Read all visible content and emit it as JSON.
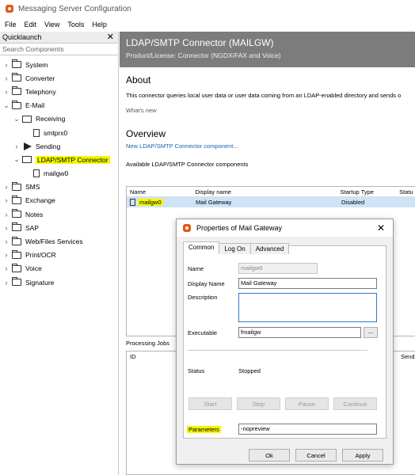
{
  "window": {
    "title": "Messaging Server Configuration"
  },
  "menu": [
    "File",
    "Edit",
    "View",
    "Tools",
    "Help"
  ],
  "quicklaunch": {
    "title": "Quicklaunch",
    "close_glyph": "✕",
    "search_placeholder": "Search Components",
    "tree": [
      {
        "label": "System",
        "chevron": "›"
      },
      {
        "label": "Converter",
        "chevron": "›"
      },
      {
        "label": "Telephony",
        "chevron": "›"
      },
      {
        "label": "E-Mail",
        "chevron": "⌄"
      },
      {
        "label": "Receiving",
        "chevron": "⌄"
      },
      {
        "label": "smtprx0"
      },
      {
        "label": "Sending",
        "chevron": "›"
      },
      {
        "label": "LDAP/SMTP Connector",
        "chevron": "⌄"
      },
      {
        "label": "mailgw0"
      },
      {
        "label": "SMS",
        "chevron": "›"
      },
      {
        "label": "Exchange",
        "chevron": "›"
      },
      {
        "label": "Notes",
        "chevron": "›"
      },
      {
        "label": "SAP",
        "chevron": "›"
      },
      {
        "label": "Web/Files Services",
        "chevron": "›"
      },
      {
        "label": "Print/OCR",
        "chevron": "›"
      },
      {
        "label": "Voice",
        "chevron": "›"
      },
      {
        "label": "Signature",
        "chevron": "›"
      }
    ]
  },
  "main": {
    "header_title": "LDAP/SMTP Connector (MAILGW)",
    "header_subtitle": "Product/License: Connector (NGDX/FAX and Voice)",
    "about_title": "About",
    "about_text": "This connector queries local user data or user data coming from an LDAP-enabled directory and sends o",
    "whats_new": "What's new",
    "overview_title": "Overview",
    "new_link": "New LDAP/SMTP Connector component...",
    "available_label": "Available LDAP/SMTP Connector components",
    "columns": [
      "Name",
      "Display name",
      "Startup Type",
      "Statu"
    ],
    "row": {
      "name": "mailgw0",
      "display": "Mail Gateway",
      "startup": "Disabled"
    },
    "processing_label": "Processing Jobs",
    "jobs_columns": [
      "ID",
      "Send"
    ]
  },
  "dialog": {
    "title": "Properties of Mail Gateway",
    "close_glyph": "✕",
    "tabs": [
      "Common",
      "Log On",
      "Advanced"
    ],
    "name_label": "Name",
    "name_value": "mailgw0",
    "display_label": "Display Name",
    "display_value": "Mail Gateway",
    "description_label": "Description",
    "description_value": "",
    "executable_label": "Executable",
    "executable_value": "fmailgw",
    "browse_label": "...",
    "status_label": "Status",
    "status_value": "Stopped",
    "action_buttons": [
      "Start",
      "Stop",
      "Pause",
      "Continue"
    ],
    "params_label": "Parameters",
    "params_value": "-nopreview",
    "ok": "Ok",
    "cancel": "Cancel",
    "apply": "Apply"
  },
  "colors": {
    "highlight": "#f4f700",
    "banner": "#7c7c7c",
    "selection": "#cfe3f8",
    "app_icon": "#e25a1c"
  }
}
